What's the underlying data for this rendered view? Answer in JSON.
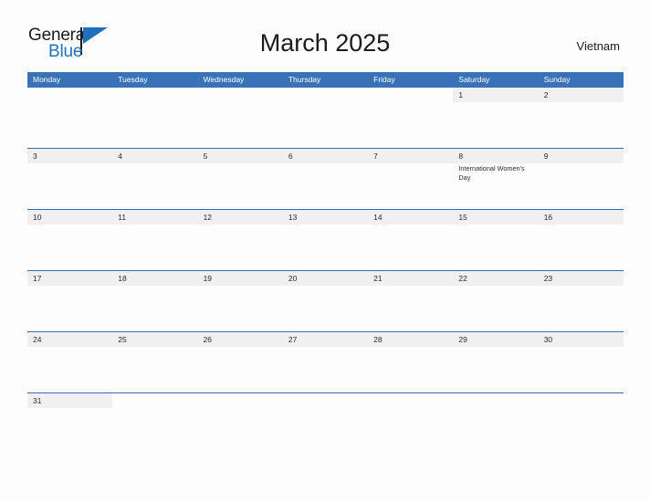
{
  "brand": {
    "name_part1": "General",
    "name_part2": "Blue",
    "flag_icon": "flag-icon",
    "colors": {
      "accent": "#1f72ba",
      "dark": "#1b1b1b"
    }
  },
  "header": {
    "title": "March 2025",
    "country": "Vietnam"
  },
  "theme": {
    "header_blue": "#3a72b8",
    "row_rule_blue": "#2f6fb5",
    "date_band_gray": "#f0f0f0",
    "page_background": "#fdfdfd"
  },
  "weekdays": [
    "Monday",
    "Tuesday",
    "Wednesday",
    "Thursday",
    "Friday",
    "Saturday",
    "Sunday"
  ],
  "weeks": [
    {
      "days": [
        {
          "number": "",
          "events": []
        },
        {
          "number": "",
          "events": []
        },
        {
          "number": "",
          "events": []
        },
        {
          "number": "",
          "events": []
        },
        {
          "number": "",
          "events": []
        },
        {
          "number": "1",
          "events": []
        },
        {
          "number": "2",
          "events": []
        }
      ]
    },
    {
      "days": [
        {
          "number": "3",
          "events": []
        },
        {
          "number": "4",
          "events": []
        },
        {
          "number": "5",
          "events": []
        },
        {
          "number": "6",
          "events": []
        },
        {
          "number": "7",
          "events": []
        },
        {
          "number": "8",
          "events": [
            "International Women's Day"
          ]
        },
        {
          "number": "9",
          "events": []
        }
      ]
    },
    {
      "days": [
        {
          "number": "10",
          "events": []
        },
        {
          "number": "11",
          "events": []
        },
        {
          "number": "12",
          "events": []
        },
        {
          "number": "13",
          "events": []
        },
        {
          "number": "14",
          "events": []
        },
        {
          "number": "15",
          "events": []
        },
        {
          "number": "16",
          "events": []
        }
      ]
    },
    {
      "days": [
        {
          "number": "17",
          "events": []
        },
        {
          "number": "18",
          "events": []
        },
        {
          "number": "19",
          "events": []
        },
        {
          "number": "20",
          "events": []
        },
        {
          "number": "21",
          "events": []
        },
        {
          "number": "22",
          "events": []
        },
        {
          "number": "23",
          "events": []
        }
      ]
    },
    {
      "days": [
        {
          "number": "24",
          "events": []
        },
        {
          "number": "25",
          "events": []
        },
        {
          "number": "26",
          "events": []
        },
        {
          "number": "27",
          "events": []
        },
        {
          "number": "28",
          "events": []
        },
        {
          "number": "29",
          "events": []
        },
        {
          "number": "30",
          "events": []
        }
      ]
    },
    {
      "days": [
        {
          "number": "31",
          "events": []
        },
        {
          "number": "",
          "events": []
        },
        {
          "number": "",
          "events": []
        },
        {
          "number": "",
          "events": []
        },
        {
          "number": "",
          "events": []
        },
        {
          "number": "",
          "events": []
        },
        {
          "number": "",
          "events": []
        }
      ]
    }
  ]
}
